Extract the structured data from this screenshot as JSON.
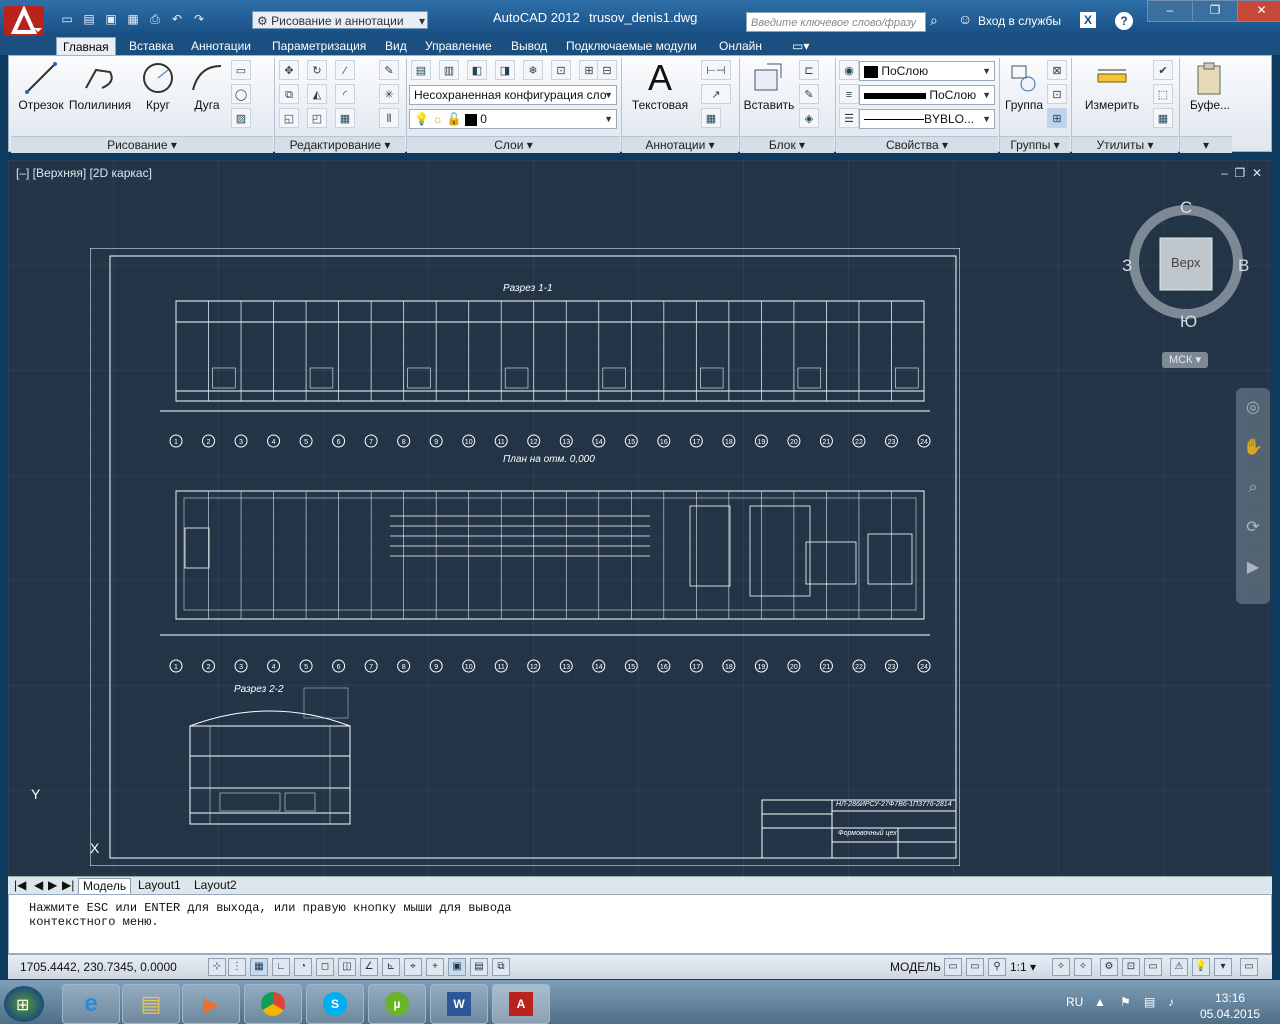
{
  "app": {
    "title": "AutoCAD 2012",
    "file": "trusov_denis1.dwg"
  },
  "workspace": "Рисование и аннотации",
  "search": {
    "placeholder": "Введите ключевое слово/фразу"
  },
  "signin": "Вход в службы",
  "tabs": [
    "Главная",
    "Вставка",
    "Аннотации",
    "Параметризация",
    "Вид",
    "Управление",
    "Вывод",
    "Подключаемые модули",
    "Онлайн"
  ],
  "panels": {
    "draw": {
      "title": "Рисование",
      "buttons": [
        "Отрезок",
        "Полилиния",
        "Круг",
        "Дуга"
      ]
    },
    "modify": {
      "title": "Редактирование"
    },
    "layers": {
      "title": "Слои",
      "state": "Несохраненная конфигурация сло",
      "current": "0"
    },
    "annotation": {
      "title": "Аннотации",
      "text_button": "Текстовая"
    },
    "block": {
      "title": "Блок",
      "insert_button": "Вставить"
    },
    "properties": {
      "title": "Свойства",
      "color": "ПоСлою",
      "lineweight": "ПоСлою",
      "linetype": "BYBLO..."
    },
    "groups": {
      "title": "Группы",
      "group_button": "Группа"
    },
    "utilities": {
      "title": "Утилиты",
      "measure_button": "Измерить"
    },
    "clipboard": {
      "button": "Буфе..."
    }
  },
  "viewport": {
    "label": "[–] [Верхняя] [2D каркас]",
    "viewcube": {
      "face": "Верх",
      "north": "С",
      "south": "Ю",
      "west": "З",
      "east": "В",
      "ucs": "МСК"
    }
  },
  "drawing": {
    "section1": "Разрез 1-1",
    "plan": "План на отм. 0,000",
    "section2": "Разрез 2-2",
    "stamp_code": "НЛ-286ИРСУ-27Ф7В6-1П3776-2814",
    "stamp_title": "Формовочный цех",
    "axis_numbers": [
      "1",
      "2",
      "3",
      "4",
      "5",
      "6",
      "7",
      "8",
      "9",
      "10",
      "11",
      "12",
      "13",
      "14",
      "15",
      "16",
      "17",
      "18",
      "19",
      "20",
      "21",
      "22",
      "23",
      "24"
    ],
    "row_letters": [
      "Б",
      "А"
    ]
  },
  "layout_tabs": [
    "Модель",
    "Layout1",
    "Layout2"
  ],
  "command_lines": [
    "Нажмите ESC или ENTER для выхода, или правую кнопку мыши для вывода",
    "контекстного меню."
  ],
  "status": {
    "coords": "1705.4442, 230.7345, 0.0000",
    "model": "МОДЕЛЬ",
    "scale": "1:1"
  },
  "tray": {
    "lang": "RU",
    "time": "13:16",
    "date": "05.04.2015"
  },
  "colors": {
    "accent": "#174f84",
    "viewport_bg": "#233446",
    "drawing": "#ffffff",
    "titleblock_red": "#c74836"
  }
}
